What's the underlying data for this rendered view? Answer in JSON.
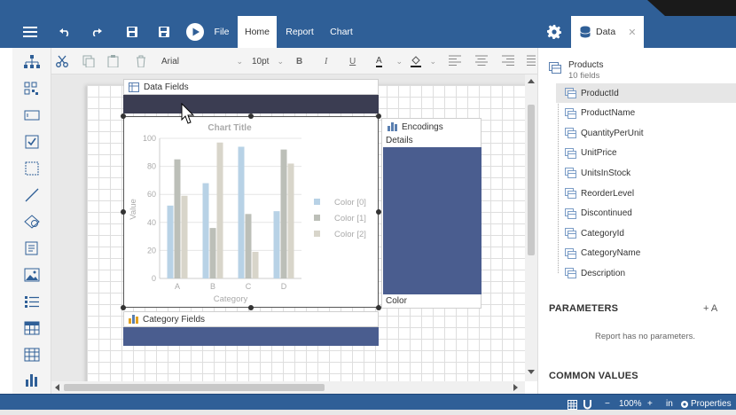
{
  "topbar": {
    "file": "File",
    "home": "Home",
    "report": "Report",
    "chart": "Chart",
    "data_tab": "Data",
    "close_glyph": "✕"
  },
  "format": {
    "font": "Arial",
    "size": "10pt",
    "bold": "B",
    "italic": "I",
    "underline": "U",
    "font_color_glyph": "A"
  },
  "designer": {
    "data_fields": "Data Fields",
    "category_fields": "Category Fields",
    "encodings": "Encodings",
    "details": "Details",
    "color": "Color"
  },
  "chart_data": {
    "type": "bar",
    "title": "Chart Title",
    "xlabel": "Category",
    "ylabel": "Value",
    "categories": [
      "A",
      "B",
      "C",
      "D"
    ],
    "yticks": [
      "0",
      "20",
      "40",
      "60",
      "80",
      "100"
    ],
    "ylim": [
      0,
      100
    ],
    "legend_position": "right",
    "series": [
      {
        "name": "Color [0]",
        "color": "#b8d2e6",
        "values": [
          52,
          68,
          94,
          48
        ]
      },
      {
        "name": "Color [1]",
        "color": "#bcbfb8",
        "values": [
          85,
          36,
          46,
          92
        ]
      },
      {
        "name": "Color [2]",
        "color": "#d8d5ca",
        "values": [
          59,
          97,
          19,
          82
        ]
      }
    ]
  },
  "panel": {
    "dataset_name": "Products",
    "dataset_count": "10 fields",
    "fields": [
      "ProductId",
      "ProductName",
      "QuantityPerUnit",
      "UnitPrice",
      "UnitsInStock",
      "ReorderLevel",
      "Discontinued",
      "CategoryId",
      "CategoryName",
      "Description"
    ],
    "selected_field": "ProductId",
    "parameters_title": "PARAMETERS",
    "add_label": "+ A",
    "no_params": "Report has no parameters.",
    "common_values_title": "COMMON VALUES"
  },
  "status": {
    "zoom_minus": "−",
    "zoom": "100%",
    "zoom_plus": "+",
    "units": "in",
    "properties": "Properties"
  },
  "colors": {
    "brand": "#2f5f97",
    "band": "#4a5d8f",
    "data_band": "#3b3d52"
  }
}
